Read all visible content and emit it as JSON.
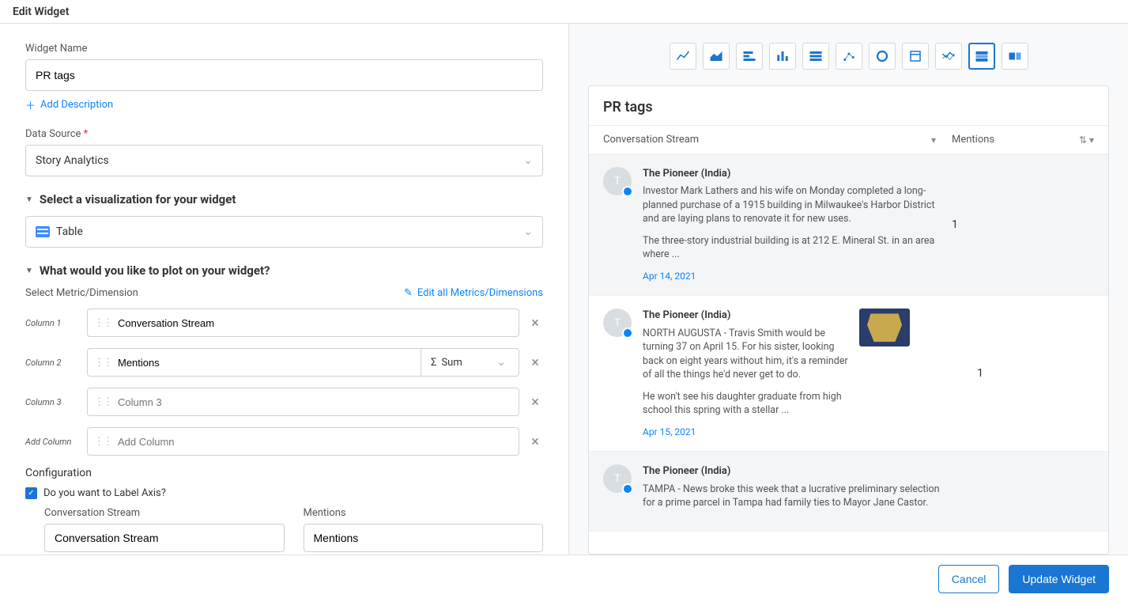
{
  "header": {
    "title": "Edit Widget"
  },
  "form": {
    "widgetName": {
      "label": "Widget Name",
      "value": "PR tags"
    },
    "addDescription": "Add Description",
    "dataSource": {
      "label": "Data Source",
      "value": "Story Analytics"
    },
    "vizSection": "Select a visualization for your widget",
    "vizValue": "Table",
    "plotSection": "What would you like to plot on your widget?",
    "selectMetricLabel": "Select Metric/Dimension",
    "editMetricsLabel": "Edit all Metrics/Dimensions",
    "columns": {
      "c1": {
        "label": "Column 1",
        "value": "Conversation Stream"
      },
      "c2": {
        "label": "Column 2",
        "value": "Mentions",
        "agg": "Sum"
      },
      "c3": {
        "label": "Column 3",
        "placeholder": "Column 3"
      },
      "add": {
        "label": "Add Column",
        "placeholder": "Add Column"
      }
    },
    "config": {
      "header": "Configuration",
      "labelAxisQ": "Do you want to Label Axis?",
      "axis1": {
        "label": "Conversation Stream",
        "value": "Conversation Stream"
      },
      "axis2": {
        "label": "Mentions",
        "value": "Mentions"
      }
    }
  },
  "preview": {
    "title": "PR tags",
    "colStream": "Conversation Stream",
    "colMentions": "Mentions",
    "rows": [
      {
        "source": "The Pioneer (India)",
        "p1": "Investor Mark Lathers and his wife on Monday completed a long-planned purchase of a 1915 building in Milwaukee's Harbor District and are laying plans to renovate it for new uses.",
        "p2": "The three-story industrial building is at 212 E. Mineral St. in an area where ...",
        "date": "Apr 14, 2021",
        "mentions": "1"
      },
      {
        "source": "The Pioneer (India)",
        "p1": "NORTH AUGUSTA - Travis Smith would be turning 37 on April 15. For his sister, looking back on eight years without him, it's a reminder of all the things he'd never get to do.",
        "p2": "He won't see his daughter graduate from high school this spring with a stellar ...",
        "date": "Apr 15, 2021",
        "mentions": "1"
      },
      {
        "source": "The Pioneer (India)",
        "p1": "TAMPA - News broke this week that a lucrative preliminary selection for a prime parcel in Tampa had family ties to Mayor Jane Castor.",
        "p2": "",
        "date": "",
        "mentions": ""
      }
    ]
  },
  "footer": {
    "cancel": "Cancel",
    "update": "Update Widget"
  }
}
